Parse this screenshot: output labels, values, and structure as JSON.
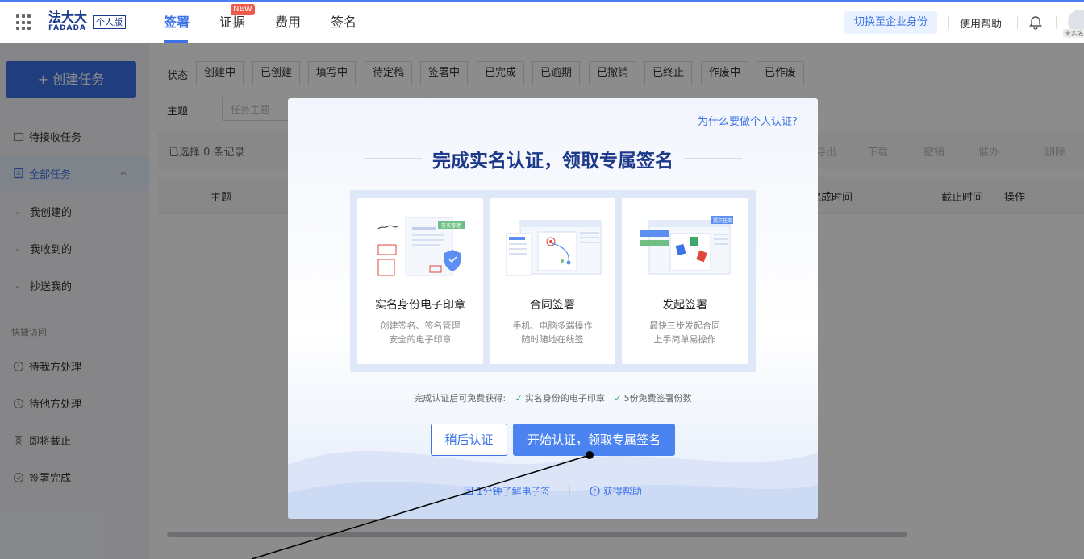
{
  "header": {
    "logo_cn": "法大大",
    "logo_en": "FADADA",
    "edition": "个人版",
    "nav": [
      {
        "label": "签署"
      },
      {
        "label": "证据",
        "badge": "NEW"
      },
      {
        "label": "费用"
      },
      {
        "label": "签名"
      }
    ],
    "switch_identity": "切换至企业身份",
    "help": "使用帮助",
    "unverified_tag": "未实名"
  },
  "sidebar": {
    "create_button": "+ 创建任务",
    "pending_receive": "待接收任务",
    "all_tasks": "全部任务",
    "sub_items": [
      "我创建的",
      "我收到的",
      "抄送我的"
    ],
    "quick_access_heading": "快捷访问",
    "quick_items": [
      "待我方处理",
      "待他方处理",
      "即将截止",
      "签署完成"
    ]
  },
  "filters": {
    "status_label": "状态",
    "statuses": [
      "创建中",
      "已创建",
      "填写中",
      "待定稿",
      "签署中",
      "已完成",
      "已逾期",
      "已撤销",
      "已终止",
      "作废中",
      "已作废"
    ],
    "subject_label": "主题",
    "subject_placeholder": "任务主题"
  },
  "toolbar": {
    "selected_text": "已选择 0 条记录",
    "actions": [
      "导出",
      "下载",
      "撤销",
      "催办",
      "删除"
    ]
  },
  "table": {
    "columns": [
      "主题",
      "完成时间",
      "截止时间",
      "操作"
    ]
  },
  "modal": {
    "why_link": "为什么要做个人认证?",
    "title": "完成实名认证，领取专属签名",
    "cards": [
      {
        "title": "实名身份电子印章",
        "desc1": "创建签名、签名管理",
        "desc2": "安全的电子印章",
        "tag": "签名管理"
      },
      {
        "title": "合同签署",
        "desc1": "手机、电脑多端操作",
        "desc2": "随时随地在线签"
      },
      {
        "title": "发起签署",
        "desc1": "最快三步发起合同",
        "desc2": "上手简单易操作",
        "tag": "提交任务"
      }
    ],
    "benefits_prefix": "完成认证后可免费获得:",
    "benefit_1": "实名身份的电子印章",
    "benefit_2": "5份免费签署份数",
    "later_button": "稍后认证",
    "start_button": "开始认证，领取专属签名",
    "learn_link": "1分钟了解电子签",
    "help_link": "获得帮助"
  },
  "colors": {
    "brand": "#3c74e8",
    "brand_dark": "#1d3a8a",
    "check": "#3aa86b",
    "new_badge": "#f05a4a"
  }
}
